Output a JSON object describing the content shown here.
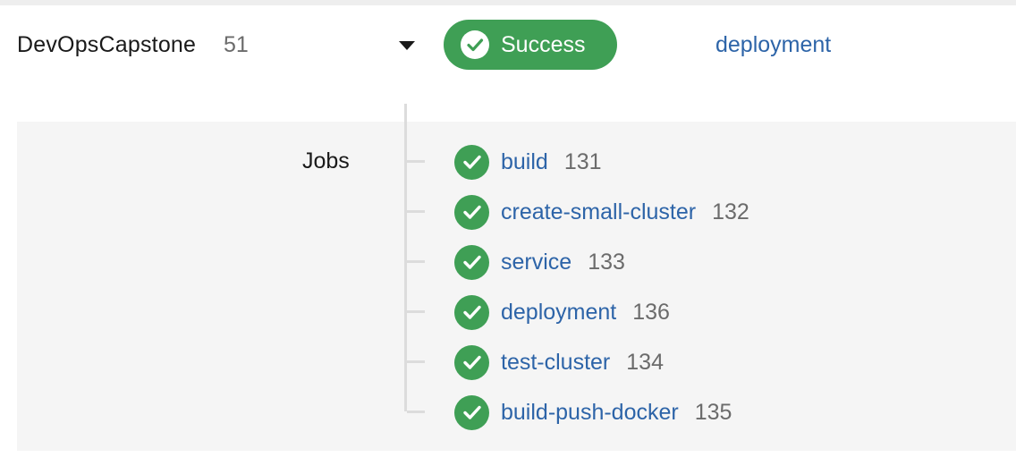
{
  "header": {
    "project_name": "DevOpsCapstone",
    "build_number": "51",
    "status": {
      "label": "Success",
      "color": "#3f9f55",
      "icon": "check-circle-icon"
    },
    "branch": "deployment"
  },
  "workflow": {
    "section_label": "Jobs",
    "jobs": [
      {
        "name": "build",
        "number": "131",
        "status": "success"
      },
      {
        "name": "create-small-cluster",
        "number": "132",
        "status": "success"
      },
      {
        "name": "service",
        "number": "133",
        "status": "success"
      },
      {
        "name": "deployment",
        "number": "136",
        "status": "success"
      },
      {
        "name": "test-cluster",
        "number": "134",
        "status": "success"
      },
      {
        "name": "build-push-docker",
        "number": "135",
        "status": "success"
      }
    ]
  },
  "colors": {
    "success": "#3f9f55",
    "link": "#2d64a8",
    "muted": "#6b6b6b"
  }
}
